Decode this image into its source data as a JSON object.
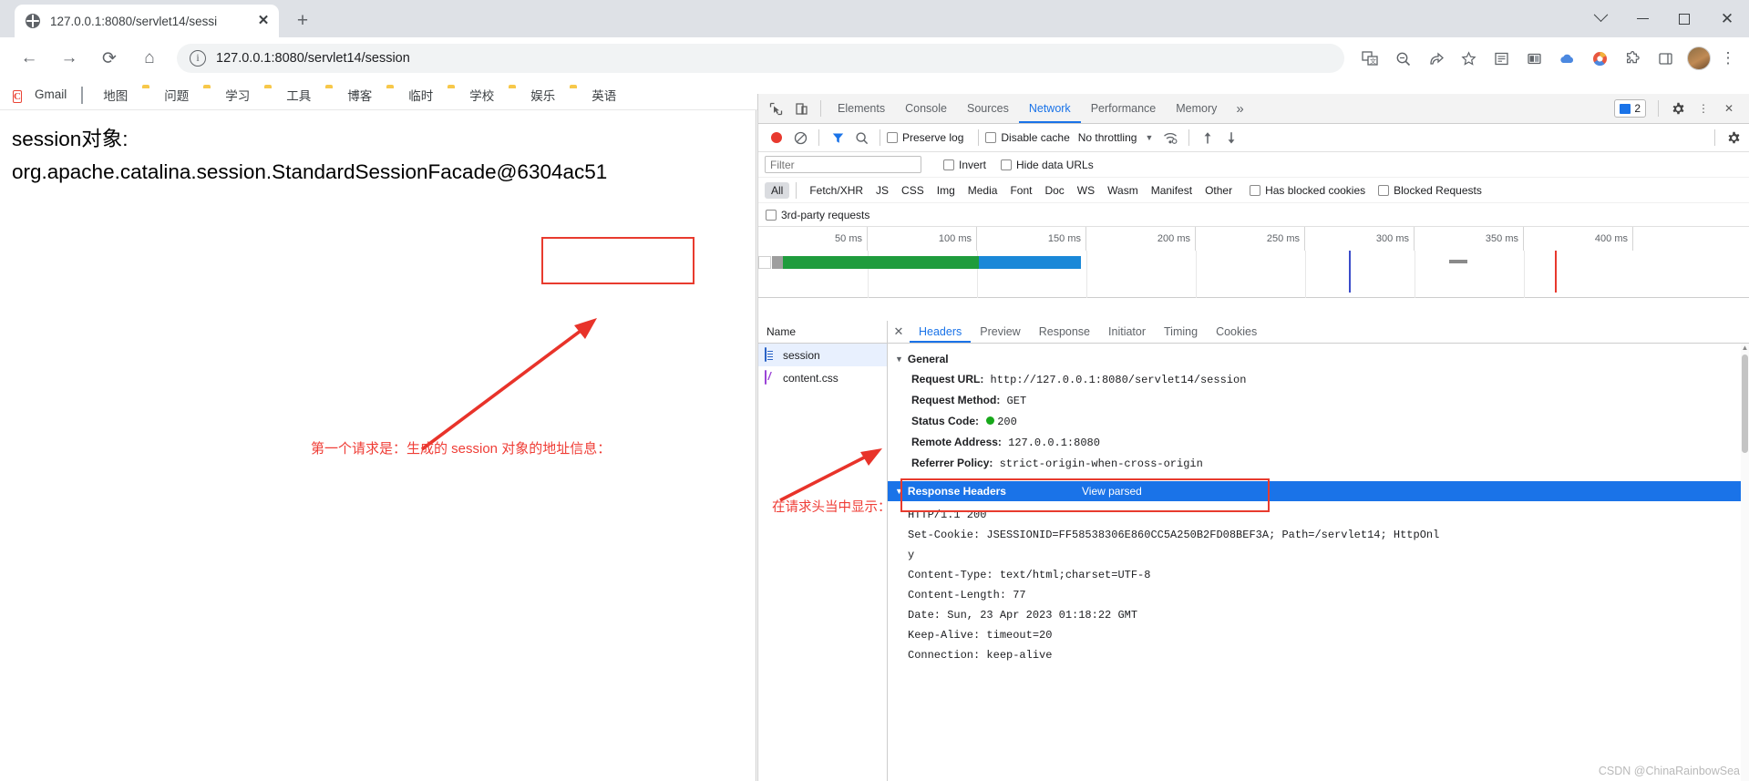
{
  "browser": {
    "tab": {
      "title": "127.0.0.1:8080/servlet14/sessi",
      "close_label": "✕"
    },
    "new_tab_label": "+",
    "window_controls": {
      "restore_down": "⌄",
      "minimize": "—",
      "maximize": "▢",
      "close": "✕"
    },
    "nav": {
      "back": "←",
      "forward": "→",
      "reload": "⟳",
      "home": "⌂"
    },
    "omnibox": {
      "url": "127.0.0.1:8080/servlet14/session",
      "info_icon": "i"
    },
    "toolbar_icons": [
      "translate-icon",
      "zoom-icon",
      "share-icon",
      "bookmark-star-icon",
      "reading-list-icon",
      "split-screen-icon",
      "cloud-icon",
      "circle-icon",
      "extensions-icon",
      "sidepanel-icon"
    ],
    "bookmarks": [
      {
        "label": "Gmail",
        "icon": "gmail-icon"
      },
      {
        "label": "地图",
        "icon": "map-icon"
      },
      {
        "label": "问题",
        "icon": "folder-icon"
      },
      {
        "label": "学习",
        "icon": "folder-icon"
      },
      {
        "label": "工具",
        "icon": "folder-icon"
      },
      {
        "label": "博客",
        "icon": "folder-icon"
      },
      {
        "label": "临时",
        "icon": "folder-icon"
      },
      {
        "label": "学校",
        "icon": "folder-icon"
      },
      {
        "label": "娱乐",
        "icon": "folder-icon"
      },
      {
        "label": "英语",
        "icon": "folder-icon"
      }
    ]
  },
  "page": {
    "line1": "session对象:",
    "line2": "org.apache.catalina.session.StandardSessionFacade@6304ac51",
    "annotation": "第一个请求是：生成的 session 对象的地址信息："
  },
  "devtools": {
    "tabs": [
      {
        "label": "Elements",
        "active": false
      },
      {
        "label": "Console",
        "active": false
      },
      {
        "label": "Sources",
        "active": false
      },
      {
        "label": "Network",
        "active": true
      },
      {
        "label": "Performance",
        "active": false
      },
      {
        "label": "Memory",
        "active": false
      }
    ],
    "more_tabs": "»",
    "issues_count": "2",
    "settings_icon": "gear-icon",
    "kebab_icon": "more-vertical-icon",
    "close_icon": "close-icon",
    "toolbar": {
      "record": "record-button",
      "clear": "clear-button",
      "filter": "filter-funnel-icon",
      "search": "search-icon",
      "preserve_log": "Preserve log",
      "disable_cache": "Disable cache",
      "throttling": "No throttling",
      "import_icon": "import-har-icon",
      "export_icon": "export-har-icon",
      "network_conditions": "network-conditions-icon",
      "settings": "network-settings-icon"
    },
    "filterbar": {
      "placeholder": "Filter",
      "value": "",
      "invert": "Invert",
      "hide_data_urls": "Hide data URLs"
    },
    "types": [
      "All",
      "Fetch/XHR",
      "JS",
      "CSS",
      "Img",
      "Media",
      "Font",
      "Doc",
      "WS",
      "Wasm",
      "Manifest",
      "Other"
    ],
    "selected_type": "All",
    "has_blocked_cookies": "Has blocked cookies",
    "blocked_requests": "Blocked Requests",
    "third_party": "3rd-party requests",
    "timeline": {
      "ticks": [
        "50 ms",
        "100 ms",
        "150 ms",
        "200 ms",
        "250 ms",
        "300 ms",
        "350 ms",
        "400 ms"
      ],
      "max_ms": 425
    },
    "requests": {
      "column_header": "Name",
      "rows": [
        {
          "name": "session",
          "icon": "doc-icon",
          "selected": true
        },
        {
          "name": "content.css",
          "icon": "css-icon",
          "selected": false
        }
      ]
    },
    "detail_tabs": [
      {
        "label": "Headers",
        "active": true
      },
      {
        "label": "Preview",
        "active": false
      },
      {
        "label": "Response",
        "active": false
      },
      {
        "label": "Initiator",
        "active": false
      },
      {
        "label": "Timing",
        "active": false
      },
      {
        "label": "Cookies",
        "active": false
      }
    ],
    "general": {
      "section_title": "General",
      "rows": [
        {
          "key": "Request URL:",
          "value": "http://127.0.0.1:8080/servlet14/session"
        },
        {
          "key": "Request Method:",
          "value": "GET"
        },
        {
          "key": "Status Code:",
          "value": "200",
          "status_dot": "#17a81a"
        },
        {
          "key": "Remote Address:",
          "value": "127.0.0.1:8080"
        },
        {
          "key": "Referrer Policy:",
          "value": "strict-origin-when-cross-origin"
        }
      ]
    },
    "response_headers": {
      "section_title": "Response Headers",
      "view_parsed": "View parsed",
      "lines": [
        "HTTP/1.1 200",
        "Set-Cookie: JSESSIONID=FF58538306E860CC5A250B2FD08BEF3A; Path=/servlet14; HttpOnl",
        "y",
        "Content-Type: text/html;charset=UTF-8",
        "Content-Length: 77",
        "Date: Sun, 23 Apr 2023 01:18:22 GMT",
        "Keep-Alive: timeout=20",
        "Connection: keep-alive"
      ]
    },
    "annotation": "在请求头当中显示："
  },
  "watermark": "CSDN @ChinaRainbowSea",
  "colors": {
    "accent_blue": "#1a73e8",
    "annotation_red": "#ef3d36",
    "box_red": "#e83b2e",
    "status_green": "#17a81a"
  }
}
